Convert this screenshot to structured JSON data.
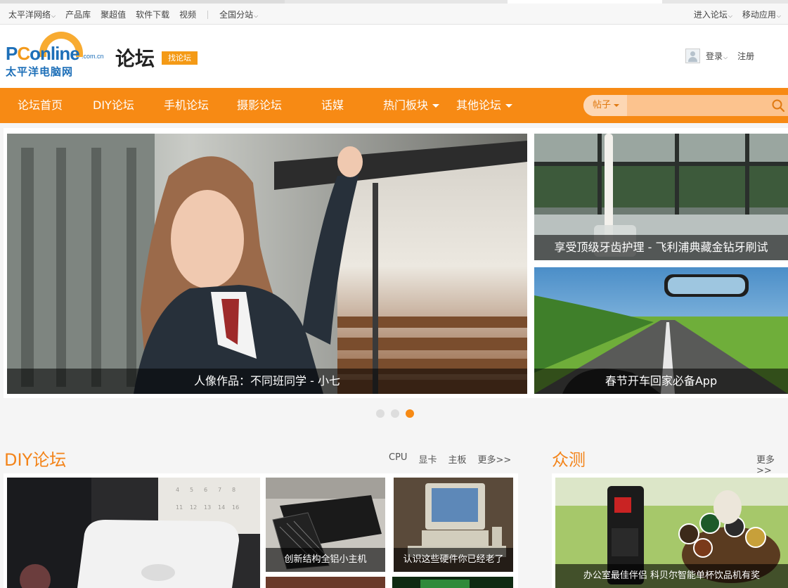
{
  "topbar": {
    "left_items": [
      "太平洋网络",
      "产品库",
      "聚超值",
      "软件下载",
      "视频"
    ],
    "region": "全国分站",
    "right_items": [
      "进入论坛",
      "移动应用"
    ]
  },
  "header": {
    "logo_latin": "PConline",
    "logo_domain": ".com.cn",
    "logo_cn": "太平洋电脑网",
    "title": "论坛",
    "find_forum": "找论坛",
    "login": "登录",
    "register": "注册"
  },
  "nav": {
    "items": [
      "论坛首页",
      "DIY论坛",
      "手机论坛",
      "摄影论坛",
      "话媒",
      "热门板块",
      "其他论坛"
    ],
    "search_scope": "帖子",
    "search_placeholder": ""
  },
  "slider": {
    "main_caption": "人像作品：不同班同学 - 小七",
    "side_captions": [
      "享受顶级牙齿护理 - 飞利浦典藏金钻牙刷试",
      "春节开车回家必备App"
    ],
    "active_dot": 3,
    "dot_count": 3
  },
  "diy": {
    "title": "DIY论坛",
    "links": [
      "CPU",
      "显卡",
      "主板",
      "更多>>"
    ],
    "cards": [
      "创新结构全铝小主机",
      "认识这些硬件你已经老了"
    ]
  },
  "review": {
    "title": "众测",
    "more": "更多>>",
    "card": "办公室最佳伴侣 科贝尔智能单杯饮品机有奖"
  },
  "colors": {
    "brand_orange": "#f78a14",
    "logo_blue": "#1d6fb8"
  }
}
